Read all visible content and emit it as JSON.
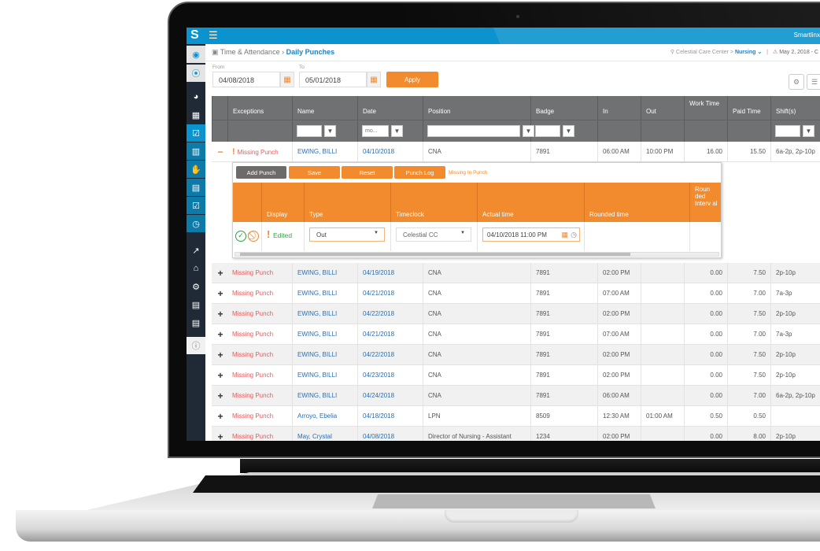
{
  "app": {
    "logo": "S",
    "menu_icon": "hamburger-icon",
    "brand": "Smartlinx"
  },
  "sidebar": {
    "items": [
      {
        "icon": "user-avatar-icon",
        "glyph": "◉"
      },
      {
        "icon": "location-pin-icon",
        "glyph": "⦿"
      },
      {
        "icon": "pie-chart-icon",
        "glyph": "◕"
      },
      {
        "icon": "calendar-grid-icon",
        "glyph": "▦"
      },
      {
        "icon": "calendar-check-icon",
        "glyph": "☑"
      },
      {
        "icon": "bar-chart-icon",
        "glyph": "▥"
      },
      {
        "icon": "hand-icon",
        "glyph": "✋"
      },
      {
        "icon": "id-card-icon",
        "glyph": "▤"
      },
      {
        "icon": "calendar-check-icon",
        "glyph": "☑"
      },
      {
        "icon": "clock-icon",
        "glyph": "◷"
      },
      {
        "icon": "line-chart-icon",
        "glyph": "↗"
      },
      {
        "icon": "bank-icon",
        "glyph": "⌂"
      },
      {
        "icon": "gears-icon",
        "glyph": "⚙"
      },
      {
        "icon": "id-card-icon",
        "glyph": "▤"
      },
      {
        "icon": "list-icon",
        "glyph": "▤"
      },
      {
        "icon": "info-icon",
        "glyph": "ⓘ"
      }
    ]
  },
  "breadcrumb": {
    "parent": "Time & Attendance",
    "separator": "›",
    "current": "Daily Punches",
    "facility": "Celestial Care Center",
    "facility_sep": ">",
    "department": "Nursing",
    "department_caret": "⌄",
    "divider": "|",
    "date_text": "May 2, 2018 - C"
  },
  "filters": {
    "from_label": "From",
    "from_value": "04/08/2018",
    "to_label": "To",
    "to_value": "05/01/2018",
    "apply_label": "Apply",
    "settings_icon": "⚙",
    "columns_icon": "☰"
  },
  "grid": {
    "columns": [
      "",
      "Exceptions",
      "Name",
      "Date",
      "Position",
      "Badge",
      "In",
      "Out",
      "Work Time",
      "Paid Time",
      "Shift(s)"
    ],
    "date_filter_placeholder": "mo...",
    "rows": [
      {
        "toggle": "−",
        "exception": "Missing Punch",
        "name": "EWING, BILLI",
        "date": "04/10/2018",
        "position": "CNA",
        "badge": "7891",
        "in": "06:00 AM",
        "out": "10:00 PM",
        "work": "16.00",
        "paid": "15.50",
        "shift": "6a-2p, 2p-10p",
        "expanded": true
      },
      {
        "toggle": "+",
        "exception": "Missing Punch",
        "name": "EWING, BILLI",
        "date": "04/19/2018",
        "position": "CNA",
        "badge": "7891",
        "in": "02:00 PM",
        "out": "",
        "work": "0.00",
        "paid": "7.50",
        "shift": "2p-10p"
      },
      {
        "toggle": "+",
        "exception": "Missing Punch",
        "name": "EWING, BILLI",
        "date": "04/21/2018",
        "position": "CNA",
        "badge": "7891",
        "in": "07:00 AM",
        "out": "",
        "work": "0.00",
        "paid": "7.00",
        "shift": "7a-3p"
      },
      {
        "toggle": "+",
        "exception": "Missing Punch",
        "name": "EWING, BILLI",
        "date": "04/22/2018",
        "position": "CNA",
        "badge": "7891",
        "in": "02:00 PM",
        "out": "",
        "work": "0.00",
        "paid": "7.50",
        "shift": "2p-10p"
      },
      {
        "toggle": "+",
        "exception": "Missing Punch",
        "name": "EWING, BILLI",
        "date": "04/21/2018",
        "position": "CNA",
        "badge": "7891",
        "in": "07:00 AM",
        "out": "",
        "work": "0.00",
        "paid": "7.00",
        "shift": "7a-3p"
      },
      {
        "toggle": "+",
        "exception": "Missing Punch",
        "name": "EWING, BILLI",
        "date": "04/22/2018",
        "position": "CNA",
        "badge": "7891",
        "in": "02:00 PM",
        "out": "",
        "work": "0.00",
        "paid": "7.50",
        "shift": "2p-10p"
      },
      {
        "toggle": "+",
        "exception": "Missing Punch",
        "name": "EWING, BILLI",
        "date": "04/23/2018",
        "position": "CNA",
        "badge": "7891",
        "in": "02:00 PM",
        "out": "",
        "work": "0.00",
        "paid": "7.50",
        "shift": "2p-10p"
      },
      {
        "toggle": "+",
        "exception": "Missing Punch",
        "name": "EWING, BILLI",
        "date": "04/24/2018",
        "position": "CNA",
        "badge": "7891",
        "in": "06:00 AM",
        "out": "",
        "work": "0.00",
        "paid": "7.00",
        "shift": "6a-2p, 2p-10p"
      },
      {
        "toggle": "+",
        "exception": "Missing Punch",
        "name": "Arroyo, Ebelia",
        "date": "04/18/2018",
        "position": "LPN",
        "badge": "8509",
        "in": "12:30 AM",
        "out": "01:00 AM",
        "work": "0.50",
        "paid": "0.50",
        "shift": ""
      },
      {
        "toggle": "+",
        "exception": "Missing Punch",
        "name": "May, Crystal",
        "date": "04/08/2018",
        "position": "Director of Nursing - Assistant",
        "badge": "1234",
        "in": "02:00 PM",
        "out": "",
        "work": "0.00",
        "paid": "8.00",
        "shift": "2p-10p"
      }
    ]
  },
  "detail": {
    "buttons": {
      "add_punch": "Add Punch",
      "save": "Save",
      "reset": "Reset",
      "punch_log": "Punch Log"
    },
    "message": "Missing In Punch",
    "columns": [
      "",
      "Display",
      "Type",
      "Timeclock",
      "Actual time",
      "Rounded time",
      "Roun ded Interv al"
    ],
    "row": {
      "display": "Edited",
      "type": "Out",
      "timeclock": "Celestial CC",
      "actual_time": "04/10/2018 11:00 PM",
      "rounded_time": "",
      "rounded_interval": ""
    }
  },
  "colors": {
    "brand_blue": "#0a93cf",
    "accent_orange": "#f28a2e",
    "exception_red": "#e35d5d",
    "link_blue": "#2a6fb3",
    "edited_green": "#3aa34a"
  }
}
